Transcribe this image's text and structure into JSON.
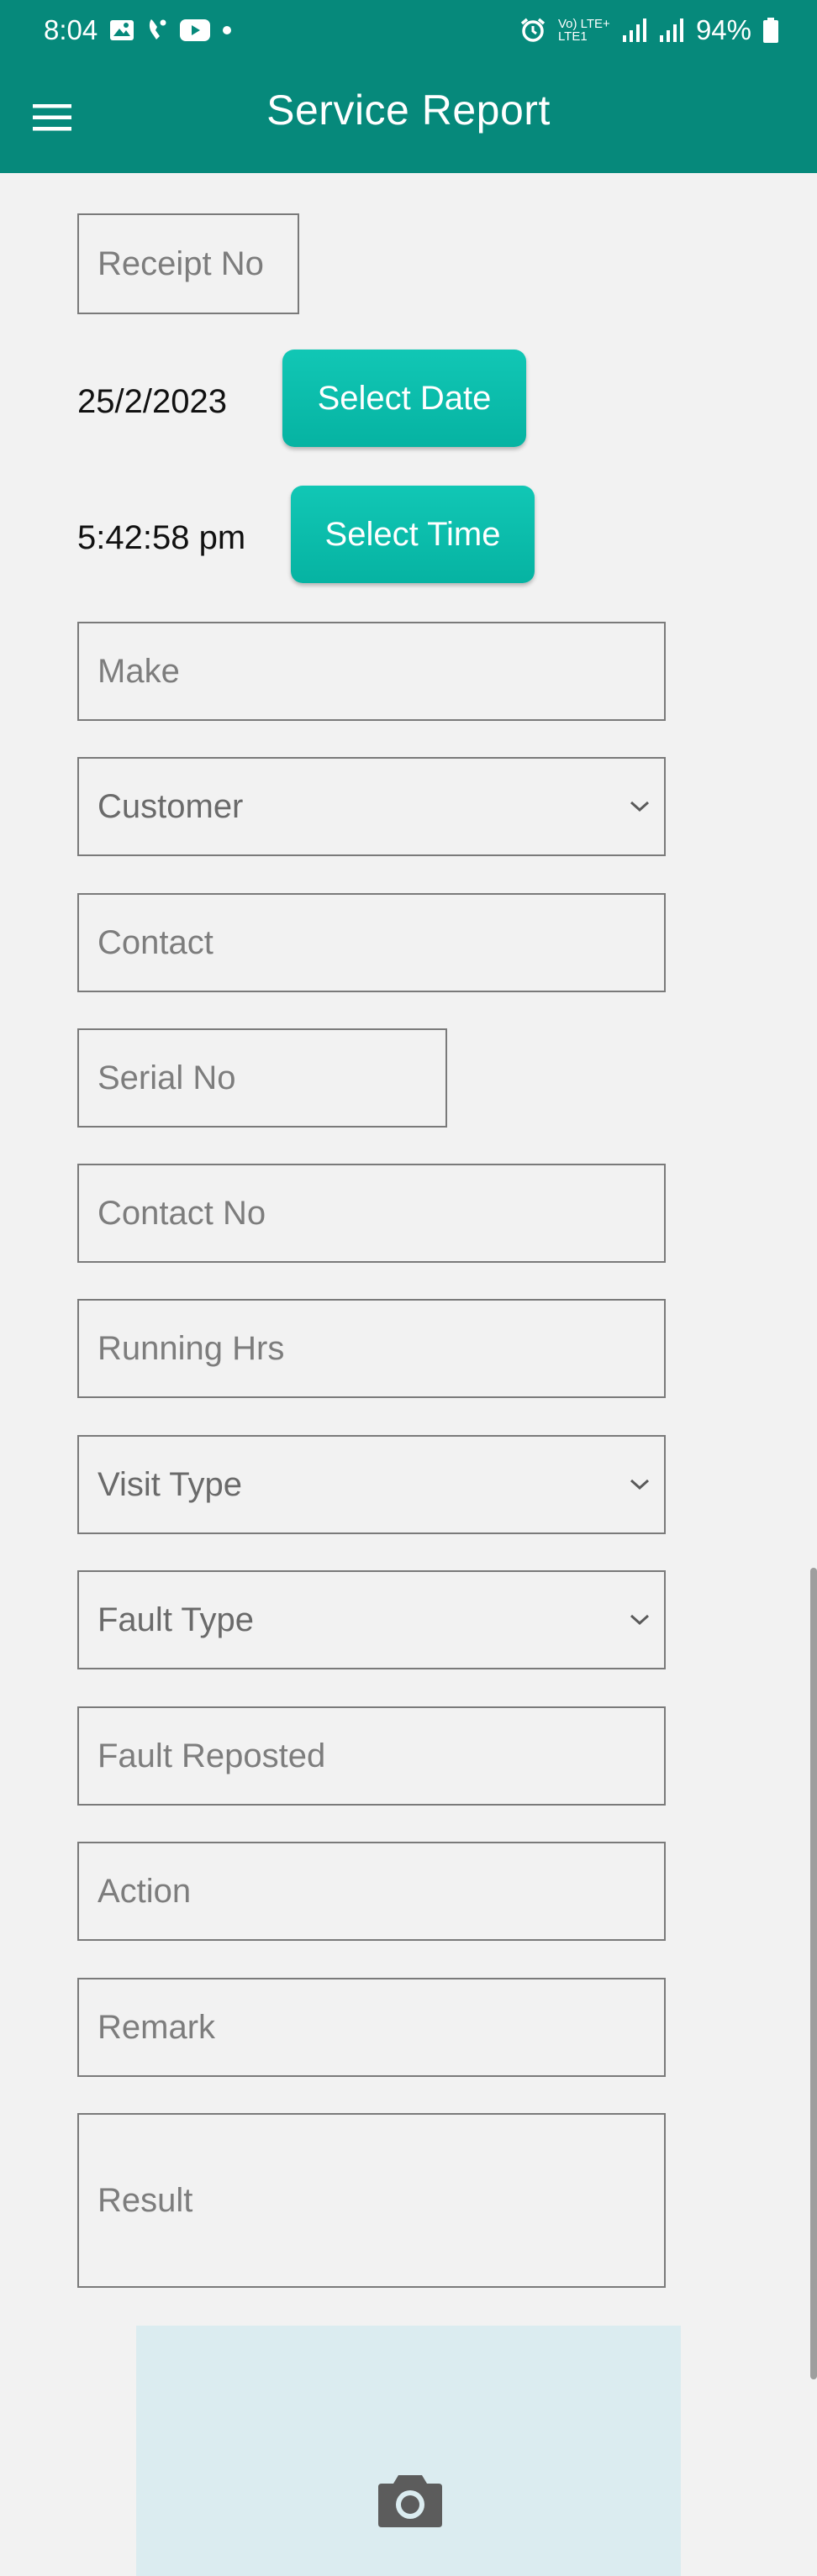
{
  "status_bar": {
    "time": "8:04",
    "battery": "94%",
    "signal_text": "Vo) LTE+ LTE1",
    "left_icons": [
      "image-icon",
      "missed-call-icon",
      "youtube-icon",
      "dot-icon"
    ],
    "right_icons": [
      "alarm-icon",
      "volte-icon",
      "signal-icon",
      "signal-icon",
      "battery-icon"
    ]
  },
  "app_bar": {
    "title": "Service Report",
    "menu_icon": "hamburger-menu-icon"
  },
  "form": {
    "receipt_no_placeholder": "Receipt No",
    "date_value": "25/2/2023",
    "select_date_label": "Select Date",
    "time_value": "5:42:58 pm",
    "select_time_label": "Select Time",
    "make_placeholder": "Make",
    "customer_selected": "Customer",
    "contact_placeholder": "Contact",
    "serial_no_placeholder": "Serial No",
    "contact_no_placeholder": "Contact No",
    "running_hrs_placeholder": "Running Hrs",
    "visit_type_selected": "Visit Type",
    "fault_type_selected": "Fault Type",
    "fault_reported_placeholder": "Fault Reposted",
    "action_placeholder": "Action",
    "remark_placeholder": "Remark",
    "result_placeholder": "Result"
  },
  "photo": {
    "icon": "camera-icon"
  },
  "colors": {
    "primary": "#06897b",
    "accent_button": "#0dbfad",
    "background": "#f2f2f2",
    "photo_area": "#dbecf0"
  }
}
